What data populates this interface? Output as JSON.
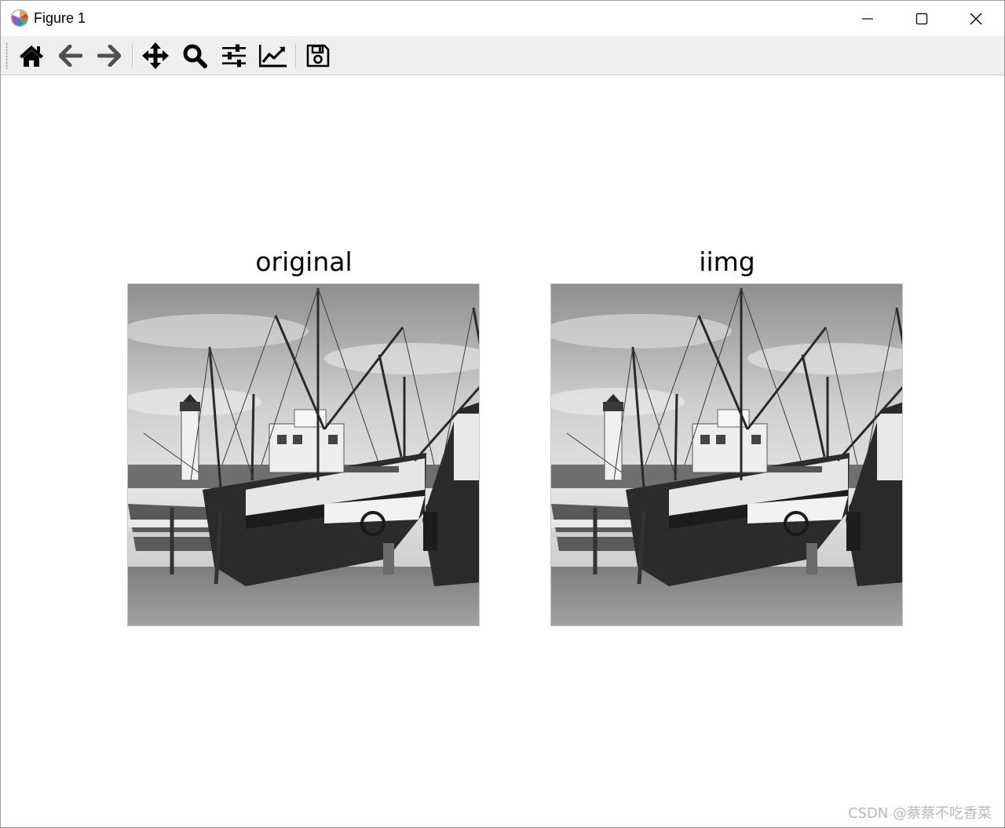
{
  "window": {
    "title": "Figure 1",
    "controls": {
      "minimize": "minimize-icon",
      "maximize": "maximize-icon",
      "close": "close-icon"
    }
  },
  "toolbar": {
    "buttons": [
      {
        "name": "home",
        "icon": "home-icon"
      },
      {
        "name": "back",
        "icon": "arrow-left-icon"
      },
      {
        "name": "forward",
        "icon": "arrow-right-icon"
      },
      {
        "name": "pan",
        "icon": "move-icon"
      },
      {
        "name": "zoom",
        "icon": "magnifier-icon"
      },
      {
        "name": "configure-subplots",
        "icon": "sliders-icon"
      },
      {
        "name": "edit-axes",
        "icon": "line-chart-icon"
      },
      {
        "name": "save",
        "icon": "floppy-disk-icon"
      }
    ]
  },
  "figure": {
    "subplots": [
      {
        "title": "original",
        "image": "grayscale photo of fishing boats on a beach"
      },
      {
        "title": "iimg",
        "image": "grayscale photo of fishing boats on a beach"
      }
    ]
  },
  "watermark": "CSDN @蔡蔡不吃香菜",
  "colors": {
    "toolbar_bg": "#efefef",
    "icon": "#000000"
  }
}
